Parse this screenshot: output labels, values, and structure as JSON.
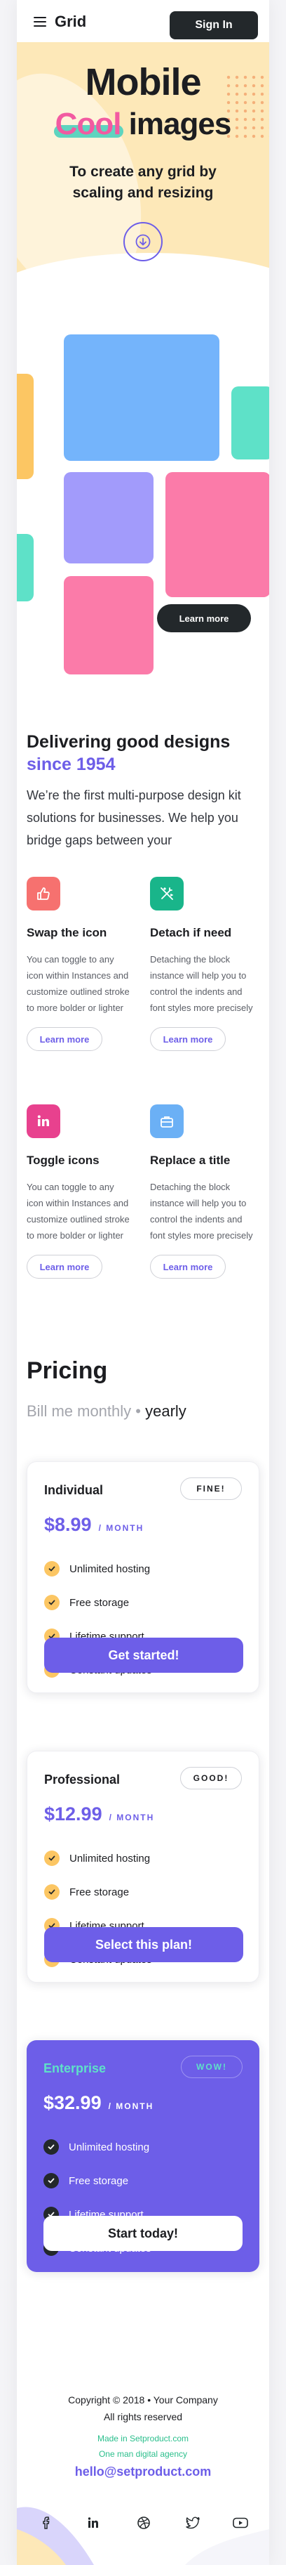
{
  "header": {
    "brand": "Grid",
    "signin_label": "Sign In"
  },
  "hero": {
    "title_line1": "Mobile",
    "title_highlight": "Cool",
    "title_rest": "images",
    "subtitle": "To create any grid by scaling and resizing"
  },
  "gallery": {
    "learn_more_label": "Learn more"
  },
  "deliver": {
    "heading": "Delivering good designs",
    "heading_accent": "since 1954",
    "body": "We’re the first multi-purpose design kit solutions for businesses. We help you bridge gaps between    your"
  },
  "features": [
    {
      "title": "Swap the icon",
      "text": "You can toggle to any icon within Instances and customize outlined stroke to more bolder or lighter",
      "button": "Learn more",
      "icon": "thumbs-up-icon",
      "color": "#f6716f"
    },
    {
      "title": "Detach if need",
      "text": "Detaching the block instance will help you to control the indents and font styles more precisely",
      "button": "Learn more",
      "icon": "magic-wand-icon",
      "color": "#19b58a"
    },
    {
      "title": "Toggle icons",
      "text": "You can toggle to any icon within Instances and customize outlined stroke to more bolder or lighter",
      "button": "Learn more",
      "icon": "linkedin-icon",
      "color": "#e8418e"
    },
    {
      "title": "Replace a title",
      "text": "Detaching the block instance will help you to control the indents and font styles more precisely",
      "button": "Learn more",
      "icon": "briefcase-icon",
      "color": "#6bb0f5"
    }
  ],
  "pricing": {
    "heading": "Pricing",
    "toggle_monthly": "Bill me monthly",
    "toggle_sep": "•",
    "toggle_yearly": "yearly",
    "plans": [
      {
        "name": "Individual",
        "badge": "FINE!",
        "price": "$8.99",
        "period": "/ MONTH",
        "features": [
          "Unlimited hosting",
          "Free storage",
          "Lifetime support",
          "Constant updates"
        ],
        "cta": "Get started!"
      },
      {
        "name": "Professional",
        "badge": "GOOD!",
        "price": "$12.99",
        "period": "/ MONTH",
        "features": [
          "Unlimited hosting",
          "Free storage",
          "Lifetime support",
          "Constant updates"
        ],
        "cta": "Select this plan!"
      },
      {
        "name": "Enterprise",
        "badge": "WOW!",
        "price": "$32.99",
        "period": "/ MONTH",
        "features": [
          "Unlimited hosting",
          "Free storage",
          "Lifetime support",
          "Constant updates"
        ],
        "cta": "Start today!"
      }
    ]
  },
  "footer": {
    "copyright": "Copyright © 2018 • Your Company",
    "rights": "All rights reserved",
    "made_in": "Made in Setproduct.com",
    "agency": "One man digital agency",
    "email": "hello@setproduct.com",
    "social_icons": [
      "facebook-icon",
      "linkedin-icon",
      "dribbble-icon",
      "twitter-icon",
      "youtube-icon"
    ]
  },
  "colors": {
    "accent": "#6d5ee8",
    "dark": "#23282b",
    "yellow": "#fcc663",
    "teal": "#5ee1c8",
    "pink": "#f25aa1"
  }
}
